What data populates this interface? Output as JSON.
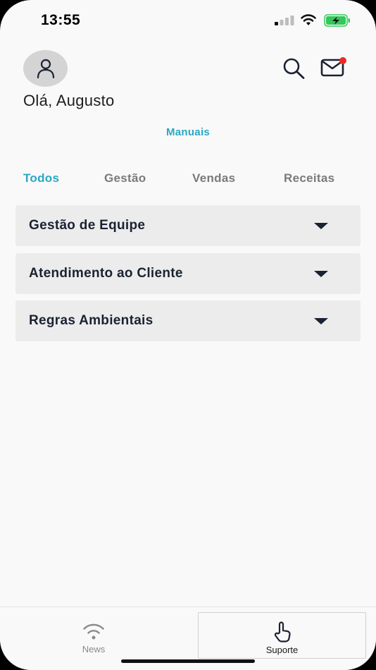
{
  "status_bar": {
    "time": "13:55",
    "signal_icon": "cellular-signal-icon",
    "wifi_icon": "wifi-icon",
    "battery_icon": "battery-charging-icon",
    "battery_color": "#34c759"
  },
  "header": {
    "avatar_icon": "user-icon",
    "greeting": "Olá, Augusto",
    "search_icon": "search-icon",
    "mail_icon": "mail-icon",
    "notification_color": "#ee2a2a"
  },
  "section_title": "Manuais",
  "tabs": [
    {
      "label": "Todos",
      "active": true
    },
    {
      "label": "Gestão",
      "active": false
    },
    {
      "label": "Vendas",
      "active": false
    },
    {
      "label": "Receitas",
      "active": false
    }
  ],
  "accordion": [
    {
      "label": "Gestão de Equipe",
      "icon": "chevron-down-icon"
    },
    {
      "label": "Atendimento ao Cliente",
      "icon": "chevron-down-icon"
    },
    {
      "label": "Regras Ambientais",
      "icon": "chevron-down-icon"
    }
  ],
  "bottom_nav": [
    {
      "label": "News",
      "icon": "wifi-icon",
      "active": false
    },
    {
      "label": "Suporte",
      "icon": "hand-pointer-icon",
      "active": true
    }
  ],
  "colors": {
    "accent": "#2aa8c2",
    "text_dark": "#1a2233",
    "tab_inactive": "#7a7a7a",
    "card_bg": "#ececec",
    "background": "#f9f9f9"
  }
}
